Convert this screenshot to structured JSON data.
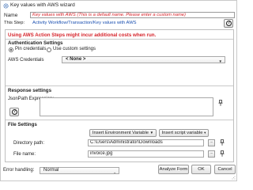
{
  "window": {
    "title": "Key values with AWS wizard"
  },
  "header": {
    "name_label": "Name",
    "name_value": "Key values with AWS  (This is a default name. Please enter a custom name)",
    "step_label": "This Step:",
    "step_link": "Activity Workflow/Transaction/Key values with AWS",
    "help_label": "?"
  },
  "warning": "Using AWS Action Steps might incur additional costs when run.",
  "authentication": {
    "title": "Authentication Settings",
    "radio_pin": "Pin credentials",
    "radio_custom": "Use custom settings",
    "credentials_label": "AWS Credentials",
    "credentials_value": "< None >"
  },
  "response": {
    "title": "Response settings",
    "jsonpath_label": "JsonPath Expression:",
    "help_label": "?"
  },
  "file_settings": {
    "title": "File Settings",
    "insert_env_label": "Insert Environment Variable",
    "insert_script_label": "Insert script variable",
    "directory_label": "Directory path:",
    "directory_value": "C:\\Users\\Administrator\\Downloads",
    "file_label": "File name:",
    "file_value": "invoice.jpg",
    "browse_label": "..."
  },
  "footer": {
    "error_label": "Error handling:",
    "error_value": "Normal",
    "analyze_label": "Analyze Form",
    "ok_label": "OK",
    "cancel_label": "Cancel"
  }
}
